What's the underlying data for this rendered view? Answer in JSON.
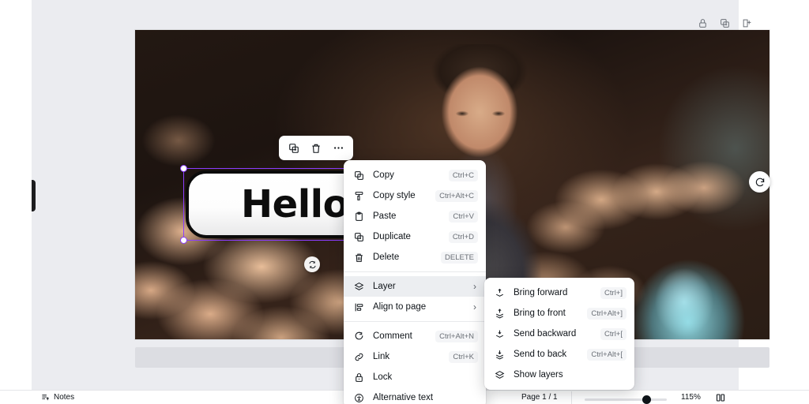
{
  "app": {
    "canvas_zoom": "115%",
    "page_indicator": "Page 1 / 1",
    "notes_label": "Notes"
  },
  "canvas": {
    "selected_element_text": "Hello",
    "selection_color": "#8b3dff",
    "background_description": "dark-bokeh-portrait"
  },
  "element_toolbar": {
    "items": [
      {
        "name": "duplicate-icon",
        "label": "Duplicate"
      },
      {
        "name": "delete-icon",
        "label": "Delete"
      },
      {
        "name": "more-options-icon",
        "label": "More options"
      }
    ]
  },
  "page_tools": {
    "items": [
      {
        "name": "lock-icon",
        "label": "Lock page"
      },
      {
        "name": "duplicate-page-icon",
        "label": "Duplicate page"
      },
      {
        "name": "export-page-icon",
        "label": "Export page"
      }
    ]
  },
  "animate_button": {
    "label": "Animate",
    "icon": "rotate-plus-icon"
  },
  "context_menu": {
    "groups": [
      {
        "items": [
          {
            "icon": "copy-icon",
            "label": "Copy",
            "shortcut": "Ctrl+C"
          },
          {
            "icon": "copy-style-icon",
            "label": "Copy style",
            "shortcut": "Ctrl+Alt+C"
          },
          {
            "icon": "paste-icon",
            "label": "Paste",
            "shortcut": "Ctrl+V"
          },
          {
            "icon": "duplicate-icon",
            "label": "Duplicate",
            "shortcut": "Ctrl+D"
          },
          {
            "icon": "delete-icon",
            "label": "Delete",
            "shortcut": "DELETE"
          }
        ]
      },
      {
        "items": [
          {
            "icon": "layer-icon",
            "label": "Layer",
            "submenu": true,
            "active": true
          },
          {
            "icon": "align-to-page-icon",
            "label": "Align to page",
            "submenu": true
          }
        ]
      },
      {
        "items": [
          {
            "icon": "comment-icon",
            "label": "Comment",
            "shortcut": "Ctrl+Alt+N"
          },
          {
            "icon": "link-icon",
            "label": "Link",
            "shortcut": "Ctrl+K"
          },
          {
            "icon": "lock-icon",
            "label": "Lock"
          },
          {
            "icon": "alternative-text-icon",
            "label": "Alternative text"
          }
        ]
      }
    ]
  },
  "layer_submenu": {
    "items": [
      {
        "icon": "bring-forward-icon",
        "label": "Bring forward",
        "shortcut": "Ctrl+]"
      },
      {
        "icon": "bring-to-front-icon",
        "label": "Bring to front",
        "shortcut": "Ctrl+Alt+]"
      },
      {
        "icon": "send-backward-icon",
        "label": "Send backward",
        "shortcut": "Ctrl+["
      },
      {
        "icon": "send-to-back-icon",
        "label": "Send to back",
        "shortcut": "Ctrl+Alt+["
      },
      {
        "icon": "show-layers-icon",
        "label": "Show layers"
      }
    ]
  }
}
